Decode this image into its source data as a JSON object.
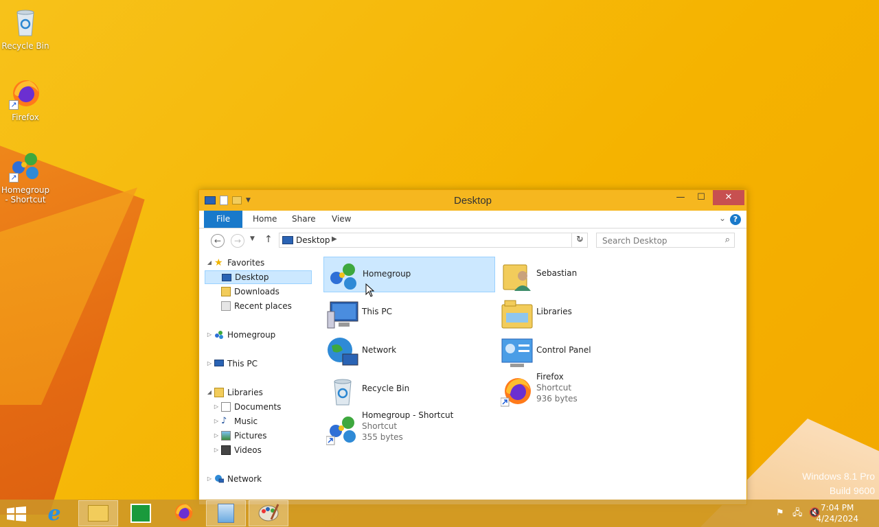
{
  "desktop": {
    "icons": [
      {
        "label": "Recycle Bin"
      },
      {
        "label": "Firefox"
      },
      {
        "label": "Homegroup - Shortcut"
      }
    ],
    "watermark_line1": "Windows 8.1 Pro",
    "watermark_line2": "Build 9600"
  },
  "window": {
    "title": "Desktop",
    "ribbon_tabs": [
      "File",
      "Home",
      "Share",
      "View"
    ],
    "address": "Desktop",
    "search_placeholder": "Search Desktop",
    "nav": {
      "favorites": "Favorites",
      "desktop": "Desktop",
      "downloads": "Downloads",
      "recent": "Recent places",
      "homegroup": "Homegroup",
      "thispc": "This PC",
      "libraries": "Libraries",
      "documents": "Documents",
      "music": "Music",
      "pictures": "Pictures",
      "videos": "Videos",
      "network": "Network"
    },
    "items": [
      {
        "name": "Homegroup"
      },
      {
        "name": "Sebastian"
      },
      {
        "name": "This PC"
      },
      {
        "name": "Libraries"
      },
      {
        "name": "Network"
      },
      {
        "name": "Control Panel"
      },
      {
        "name": "Recycle Bin"
      },
      {
        "name": "Firefox",
        "type": "Shortcut",
        "size": "936 bytes"
      },
      {
        "name": "Homegroup - Shortcut",
        "type": "Shortcut",
        "size": "355 bytes"
      }
    ]
  },
  "taskbar": {
    "time": "7:04 PM",
    "date": "4/24/2024"
  },
  "colors": {
    "titlebar": "#f6b71f",
    "accent": "#1979ca",
    "selection": "#cce8ff",
    "close": "#c75050"
  }
}
